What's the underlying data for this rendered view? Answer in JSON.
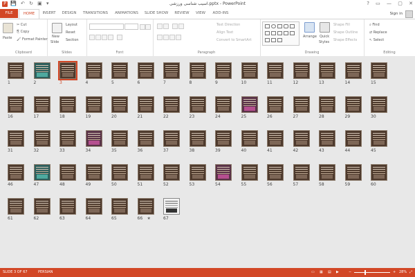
{
  "window": {
    "title": "اسیب شناسی ورزشی.pptx - PowerPoint",
    "controls": [
      "?",
      "▭",
      "—",
      "▢",
      "✕"
    ]
  },
  "tabs": [
    "FILE",
    "HOME",
    "INSERT",
    "DESIGN",
    "TRANSITIONS",
    "ANIMATIONS",
    "SLIDE SHOW",
    "REVIEW",
    "VIEW",
    "ADD-INS"
  ],
  "active_tab": "HOME",
  "sign_in": "Sign in",
  "ribbon": {
    "clipboard": {
      "label": "Clipboard",
      "paste": "Paste",
      "cut": "Cut",
      "copy": "Copy",
      "format_painter": "Format Painter"
    },
    "slides": {
      "label": "Slides",
      "new_slide": "New",
      "new_slide2": "Slide",
      "layout": "Layout",
      "reset": "Reset",
      "section": "Section"
    },
    "font": {
      "label": "Font"
    },
    "paragraph": {
      "label": "Paragraph",
      "text_direction": "Text Direction",
      "align_text": "Align Text",
      "convert_smartart": "Convert to SmartArt"
    },
    "drawing": {
      "label": "Drawing",
      "arrange": "Arrange",
      "quick_styles": "Quick",
      "quick_styles2": "Styles",
      "shape_fill": "Shape Fill",
      "shape_outline": "Shape Outline",
      "shape_effects": "Shape Effects"
    },
    "editing": {
      "label": "Editing",
      "find": "Find",
      "replace": "Replace",
      "select": "Select"
    }
  },
  "slides": {
    "count": 67,
    "selected": 3,
    "numbers": [
      "1",
      "2",
      "3",
      "4",
      "5",
      "6",
      "7",
      "8",
      "9",
      "10",
      "11",
      "12",
      "13",
      "14",
      "15",
      "16",
      "17",
      "18",
      "19",
      "20",
      "21",
      "22",
      "23",
      "24",
      "25",
      "26",
      "27",
      "28",
      "29",
      "30",
      "31",
      "32",
      "33",
      "34",
      "35",
      "36",
      "37",
      "38",
      "39",
      "40",
      "41",
      "42",
      "43",
      "44",
      "45",
      "46",
      "47",
      "48",
      "49",
      "50",
      "51",
      "52",
      "53",
      "54",
      "55",
      "56",
      "57",
      "58",
      "59",
      "60",
      "61",
      "62",
      "63",
      "64",
      "65",
      "66",
      "67"
    ]
  },
  "star": "★",
  "status": {
    "slide": "SLIDE 3 OF 67",
    "language": "PERSIAN",
    "zoom": "28%",
    "zoom_fraction": 0.28
  },
  "colors": {
    "accent": "#d24726"
  }
}
